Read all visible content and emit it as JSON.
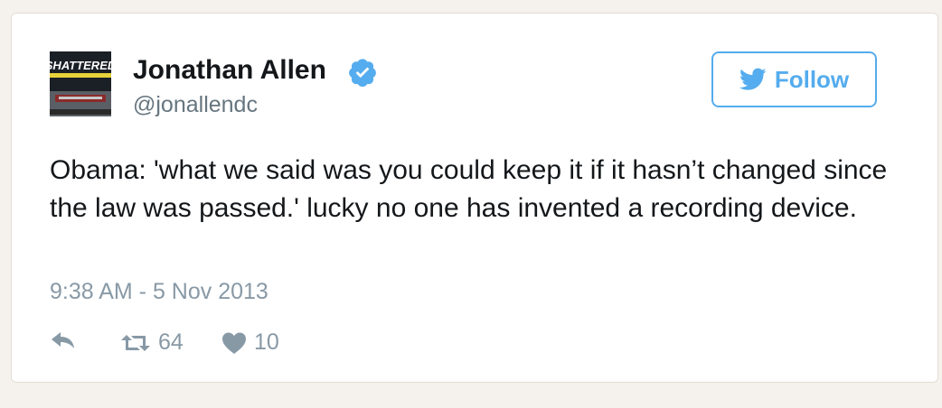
{
  "author": {
    "name": "Jonathan Allen",
    "handle": "@jonallendc",
    "avatar_text": "SHATTERED",
    "verified": true
  },
  "follow_button": {
    "label": "Follow"
  },
  "tweet": {
    "text": "Obama: 'what we said was you could keep it if it hasn’t changed since the law was passed.' lucky no one has invented a recording device.",
    "timestamp": "9:38 AM - 5 Nov 2013"
  },
  "actions": {
    "retweet_count": "64",
    "like_count": "10"
  },
  "colors": {
    "accent": "#55acee",
    "text": "#14171a",
    "muted": "#8899a6",
    "background": "#f5f2ed"
  }
}
